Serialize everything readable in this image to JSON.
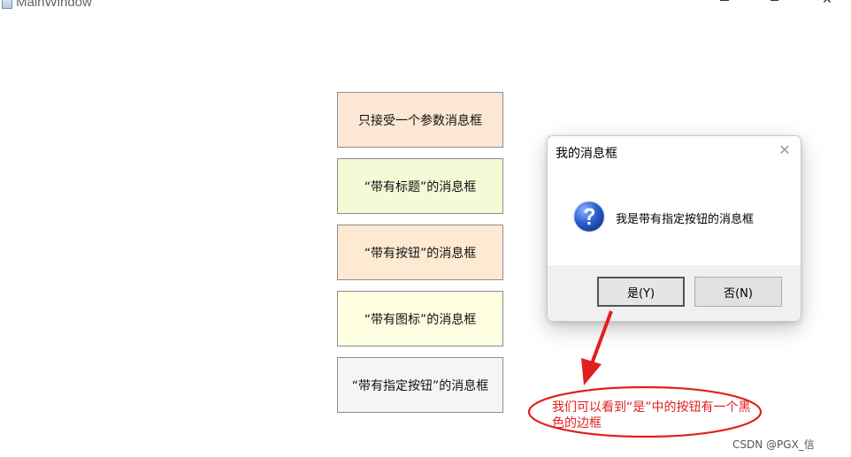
{
  "window": {
    "title": "MainWindow",
    "close_glyph": "✕"
  },
  "buttons": [
    {
      "label": "只接受一个参数消息框",
      "bg": "#fbe7d3"
    },
    {
      "label": "“带有标题”的消息框",
      "bg": "#f5fad6"
    },
    {
      "label": "“带有按钮”的消息框",
      "bg": "#feead3"
    },
    {
      "label": "“带有图标”的消息框",
      "bg": "#fefee0"
    },
    {
      "label": "“带有指定按钮”的消息框",
      "bg": "#f5f5f5"
    }
  ],
  "dialog": {
    "title": "我的消息框",
    "close_glyph": "✕",
    "icon": "question-icon",
    "message": "我是带有指定按钮的消息框",
    "yes_label": "是(Y)",
    "no_label": "否(N)"
  },
  "annotation": {
    "text": "我们可以看到“是”中的按钮有一个黑色的边框",
    "color": "#e0201f"
  },
  "watermark": "CSDN @PGX_信"
}
